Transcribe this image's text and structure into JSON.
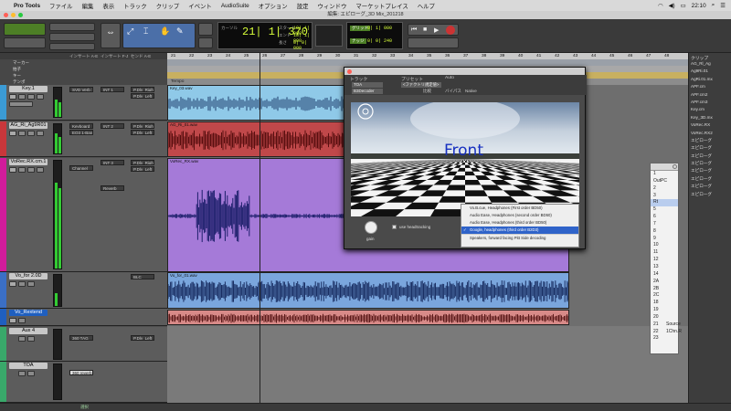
{
  "menubar": {
    "app": "Pro Tools",
    "items": [
      "ファイル",
      "編集",
      "表示",
      "トラック",
      "クリップ",
      "イベント",
      "AudioSuite",
      "オプション",
      "設定",
      "ウィンドウ",
      "マーケットプレイス",
      "ヘルプ"
    ],
    "time": "22:10"
  },
  "window": {
    "title": "編集: エピローグ_3D Mix_201218"
  },
  "toolbar": {
    "counter_main": "21| 1| 370",
    "counter_label": "カーソル",
    "start_label": "スタート",
    "end_label": "エンド",
    "length_label": "長さ",
    "start_value": "18| 1| 000",
    "end_value": "18| 1| 000",
    "length_value": "0| 0| 000",
    "grid_value": "0| 1| 000",
    "grid_label": "グリッド",
    "nudge_label": "ナッジ",
    "nudge_value": "0| 0| 240"
  },
  "tracks_header": {
    "inserts_label": "インサート A-E",
    "inserts2_label": "インサート F-J",
    "sends_label": "センド A-E",
    "rows": [
      "マーカー",
      "拍子",
      "キー",
      "テンポ"
    ]
  },
  "tracks": [
    {
      "name": "Key.1",
      "slots": [
        "SVD Verb 1",
        "INT 1",
        "P.Dly_Right",
        "P.Dly_Left"
      ],
      "volume": "-12.2"
    },
    {
      "name": "AG_Ri_Ag9R01",
      "slots": [
        "Keyboard",
        "INT 2",
        "P.Dly_Right",
        "P.Dly_Left",
        "EQ3 1-Band"
      ],
      "volume": "-5.5"
    },
    {
      "name": "VoRec.RX.cm.1",
      "slots": [
        "Channel",
        "INT 3",
        "P.Dly_Right",
        "P.Dly_Left",
        "Reverb"
      ],
      "volume": "-2.9"
    },
    {
      "name": "Vo_for 2.0D",
      "slots": [
        "BLC"
      ],
      "volume": "-8.5"
    },
    {
      "name": "Vo_Rextend",
      "slots": [],
      "volume": "0.0"
    },
    {
      "name": "Aux 4",
      "slots": [
        "360 TAG",
        "P.Dly_Left"
      ],
      "volume": "0.0"
    },
    {
      "name": "TOA",
      "slots": [
        "360 reverb"
      ],
      "volume": "0.0"
    }
  ],
  "ruler": {
    "bars": [
      "21",
      "22",
      "23",
      "24",
      "25",
      "26",
      "27",
      "28",
      "29",
      "30",
      "31",
      "32",
      "33",
      "34",
      "35",
      "36",
      "37",
      "38",
      "39",
      "40",
      "41",
      "42",
      "43",
      "44",
      "45",
      "46",
      "47",
      "48"
    ],
    "tempo_label": "Tempo"
  },
  "clips": [
    {
      "name": "Key_03.wav"
    },
    {
      "name": "AG_Ri_01.wav"
    },
    {
      "name": "VoRec_RX.wav"
    },
    {
      "name": "Vo_for_01.wav"
    }
  ],
  "plugin": {
    "track_label": "トラック",
    "preset_label": "プリセット",
    "auto_label": "Auto",
    "track_value": "TOA",
    "insert_value": "B3Decoder",
    "preset_value": "<ファクトリ規定値>",
    "compare_label": "比較",
    "bypass_label": "バイパス",
    "native_label": "Native",
    "overlay_text": "Front",
    "gain_label": "gain",
    "checkbox_label": "use headtracking"
  },
  "decoder_menu": {
    "items": [
      "Vo.B.cue, Headphones (First order BD50)",
      "Audio Ease, Headphones (second order BD50)",
      "Audio Ease, Headphones (third order BD50)",
      "Google, headphones (third order B2D3)",
      "Speakers, forward facing Pitt Side decoding"
    ],
    "selected": 3
  },
  "output_window": {
    "items": [
      "1",
      "OutPC",
      "2",
      "3",
      "Rt",
      "5",
      "6",
      "7",
      "8",
      "9",
      "10",
      "11",
      "12",
      "13",
      "14",
      "2A",
      "2B",
      "2C",
      "18",
      "19",
      "20",
      "21",
      "22",
      "23"
    ],
    "extra": [
      "Source",
      "1Chn.R"
    ],
    "selected": 4
  },
  "clip_list": {
    "label": "クリップ",
    "items": [
      "AG_Rl_Ag",
      "Ag9Ri.01",
      "AgRi.01.mx",
      "APF.cm",
      "APF.cm2",
      "APF.cm3",
      "Key.cm",
      "Key_3D.mx",
      "VoRec.RX",
      "VoRec.RX2",
      "エピローグ",
      "エピローグ",
      "エピローグ",
      "エピローグ",
      "エピローグ",
      "エピローグ",
      "エピローグ",
      "エピローグ"
    ]
  },
  "status": {
    "label": "選択"
  },
  "colors": {
    "key": "#8fc9e8",
    "ag": "#c0484a",
    "vocal": "#a57ad8",
    "vo_for": "#7aa6dd",
    "vo_rex": "#d88a88",
    "lcd_text": "#d8ff3a"
  }
}
